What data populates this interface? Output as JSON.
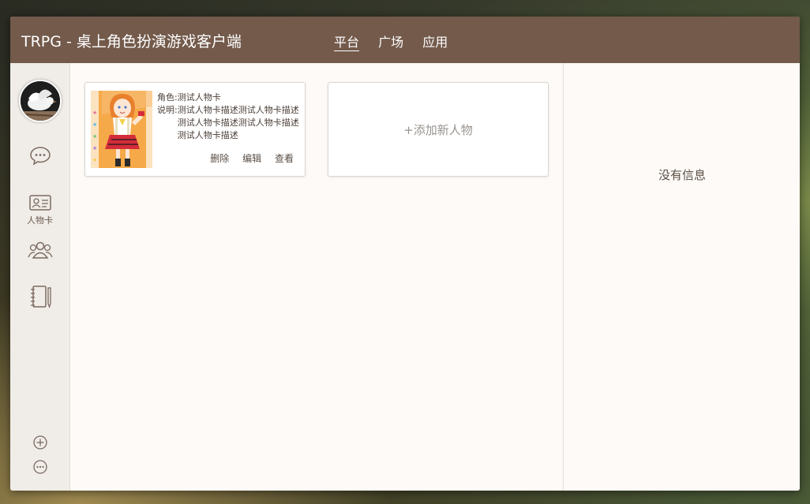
{
  "header": {
    "title": "TRPG - 桌上角色扮演游戏客户端",
    "nav": [
      {
        "label": "平台",
        "active": true
      },
      {
        "label": "广场",
        "active": false
      },
      {
        "label": "应用",
        "active": false
      }
    ]
  },
  "sidebar": {
    "items": [
      {
        "icon": "chat-bubble-icon",
        "label": ""
      },
      {
        "icon": "id-card-icon",
        "label": "人物卡"
      },
      {
        "icon": "group-icon",
        "label": ""
      },
      {
        "icon": "notebook-icon",
        "label": ""
      }
    ],
    "bottom": [
      {
        "icon": "plus-circle-icon"
      },
      {
        "icon": "more-circle-icon"
      }
    ]
  },
  "cards": [
    {
      "role_key": "角色:",
      "role_value": "测试人物卡",
      "desc_key": "说明:",
      "desc_value": "测试人物卡描述测试人物卡描述测试人物卡描述测试人物卡描述测试人物卡描述",
      "actions": {
        "delete": "删除",
        "edit": "编辑",
        "view": "查看"
      }
    }
  ],
  "add_card": {
    "label": "+添加新人物"
  },
  "right_panel": {
    "empty_message": "没有信息"
  },
  "colors": {
    "header_bg": "#735a4b",
    "content_bg": "#fdfaf7",
    "sidebar_bg": "#f0ece8"
  }
}
